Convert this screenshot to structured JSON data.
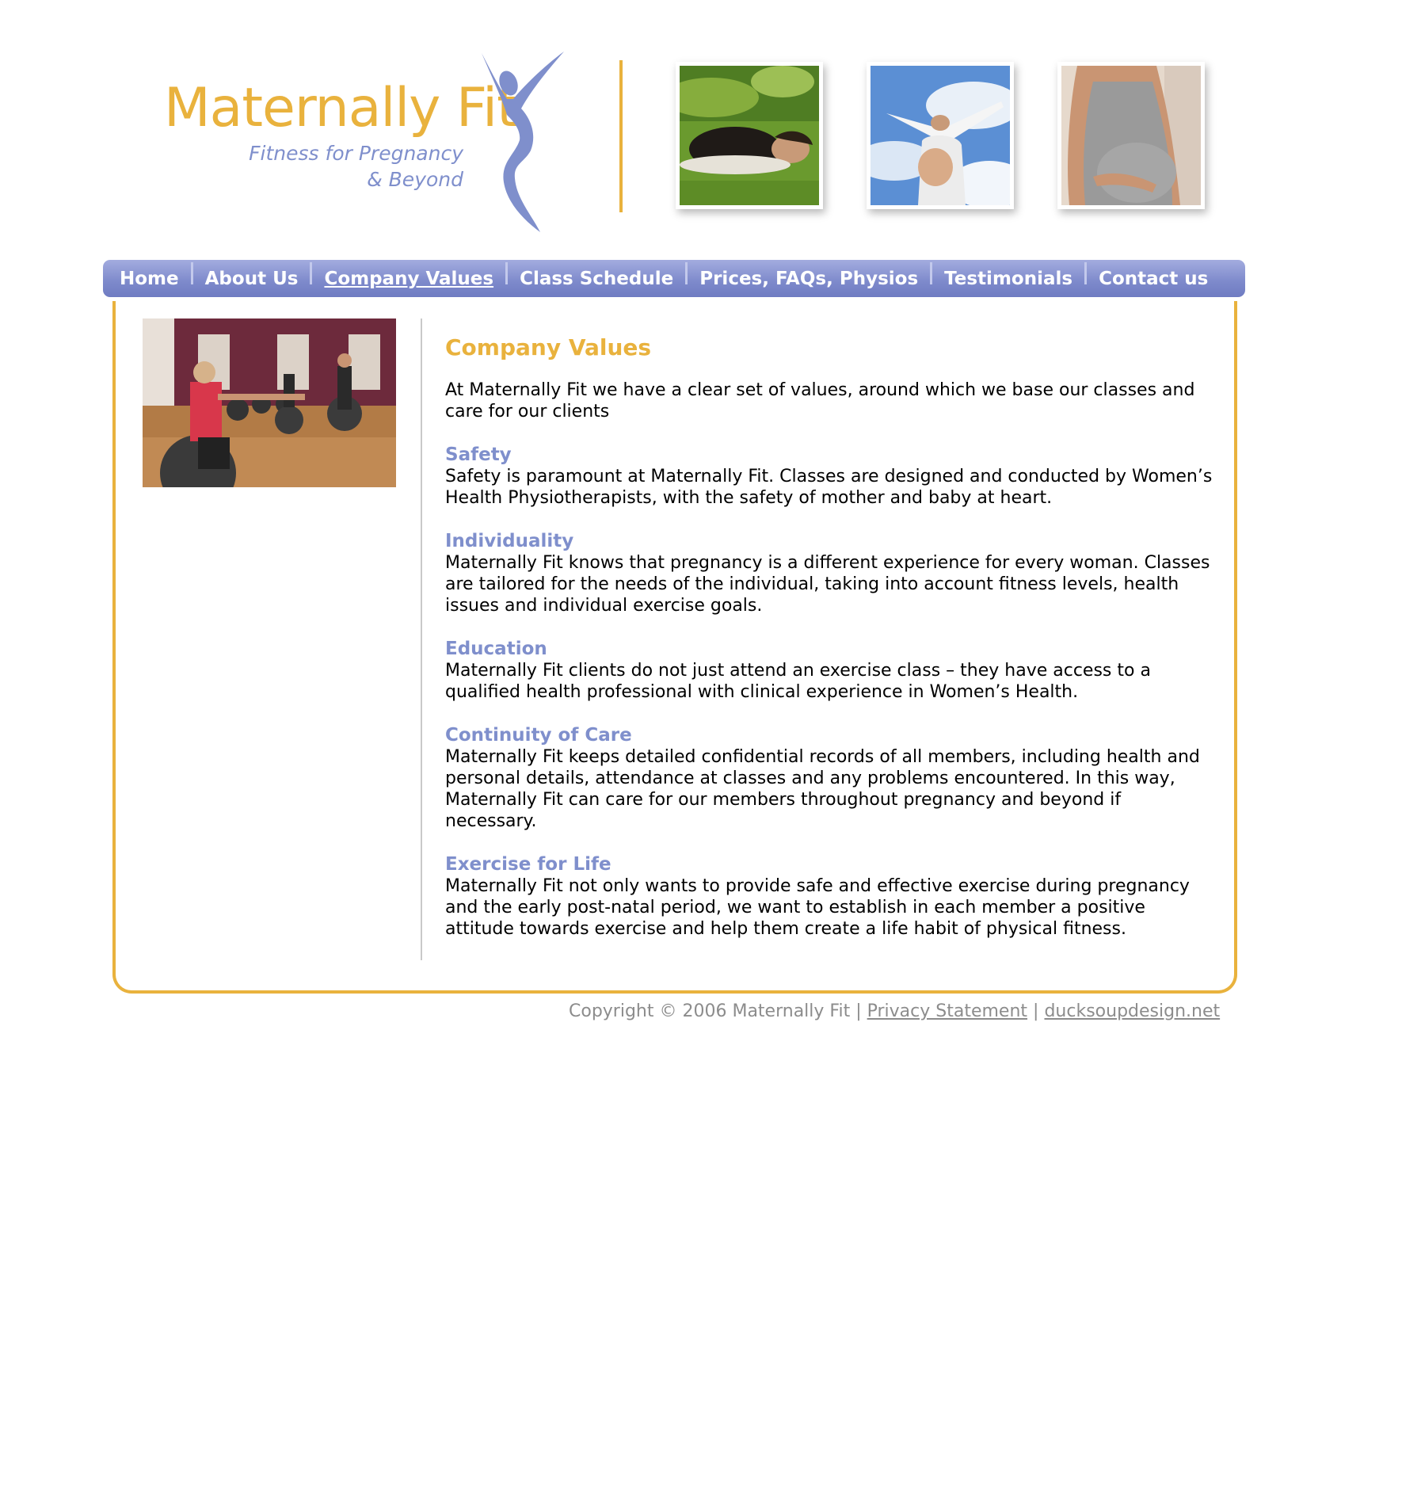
{
  "logo": {
    "name": "Maternally Fit",
    "tagline_line1": "Fitness for Pregnancy",
    "tagline_line2": "& Beyond"
  },
  "colors": {
    "brand_gold": "#e9b23d",
    "brand_periwinkle": "#7f8fcc",
    "nav_blue": "#7d89cb",
    "footer_gray": "#8c8c8c"
  },
  "header_photos": [
    {
      "icon": "pregnant-woman-lying-on-grass-photo"
    },
    {
      "icon": "pregnant-woman-arms-outstretched-sky-photo"
    },
    {
      "icon": "pregnant-woman-holding-belly-photo"
    }
  ],
  "nav": {
    "items": [
      {
        "label": "Home"
      },
      {
        "label": "About Us"
      },
      {
        "label": "Company Values",
        "active": true
      },
      {
        "label": "Class Schedule"
      },
      {
        "label": "Prices, FAQs, Physios"
      },
      {
        "label": "Testimonials"
      },
      {
        "label": "Contact us"
      }
    ]
  },
  "side_photo": {
    "icon": "exercise-ball-class-photo"
  },
  "main": {
    "title": "Company Values",
    "intro": "At Maternally Fit we have a clear set of values, around which we base our classes and care for our clients",
    "sections": [
      {
        "heading": "Safety",
        "text": "Safety is paramount at Maternally Fit. Classes are designed and conducted by Women’s Health Physiotherapists, with the safety of mother and baby at heart."
      },
      {
        "heading": "Individuality",
        "text": "Maternally Fit knows that pregnancy is a different experience for every woman. Classes are tailored for the needs of the individual, taking into account fitness levels, health issues and individual exercise goals."
      },
      {
        "heading": "Education",
        "text": "Maternally Fit clients do not just attend an exercise class – they have access to a qualified health professional with clinical experience in Women’s Health."
      },
      {
        "heading": "Continuity of Care",
        "text": "Maternally Fit keeps detailed confidential records of all members, including health and personal details, attendance at classes and any problems encountered. In this way, Maternally Fit can care for our members throughout pregnancy and beyond if necessary."
      },
      {
        "heading": "Exercise for Life",
        "text": "Maternally Fit not only wants to provide safe and effective exercise during pregnancy and the early post-natal period, we want to establish in each member a positive attitude towards exercise and help them create a life habit of physical fitness."
      }
    ]
  },
  "footer": {
    "copyright": "Copyright © 2006 Maternally Fit",
    "separator": "|",
    "privacy_label": "Privacy Statement",
    "designer_label": "ducksoupdesign.net"
  }
}
